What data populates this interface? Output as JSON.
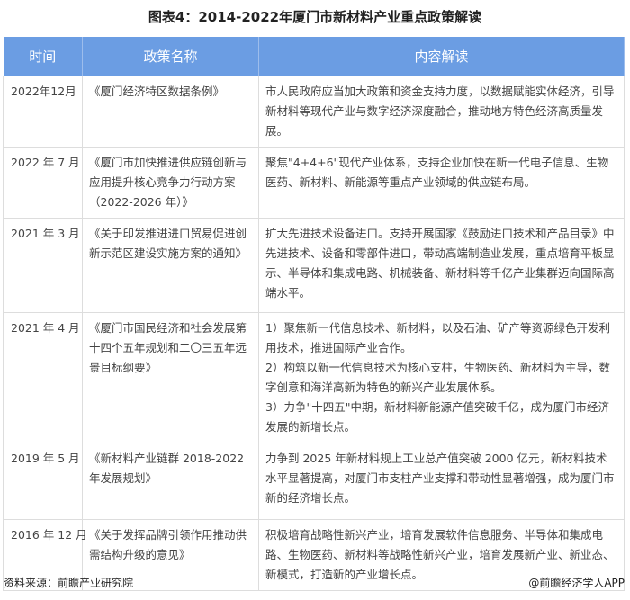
{
  "title": "图表4：2014-2022年厦门市新材料产业重点政策解读",
  "table": {
    "headers": [
      "时间",
      "政策名称",
      "内容解读"
    ],
    "rows": [
      {
        "time": "2022年12月",
        "policy": "《厦门经济特区数据条例》",
        "content": [
          "市人民政府应当加大政策和资金支持力度，以数据赋能实体经济，引导新材料等现代产业与数字经济深度融合，推动地方特色经济高质量发展。"
        ]
      },
      {
        "time": "2022 年 7 月",
        "policy": "《厦门市加快推进供应链创新与应用提升核心竞争力行动方案（2022-2026 年）》",
        "content": [
          "聚焦\"4+4+6\"现代产业体系，支持企业加快在新一代电子信息、生物医药、新材料、新能源等重点产业领域的供应链布局。"
        ]
      },
      {
        "time": "2021 年 3 月",
        "policy": "《关于印发推进进口贸易促进创新示范区建设实施方案的通知》",
        "content": [
          "扩大先进技术设备进口。支持开展国家《鼓励进口技术和产品目录》中先进技术、设备和零部件进口，带动高端制造业发展，重点培育平板显示、半导体和集成电路、机械装备、新材料等千亿产业集群迈向国际高端水平。"
        ]
      },
      {
        "time": "2021 年 4 月",
        "policy": "《厦门市国民经济和社会发展第十四个五年规划和二〇三五年远景目标纲要》",
        "content": [
          "1）聚焦新一代信息技术、新材料，以及石油、矿产等资源绿色开发利用技术，推进国际产业合作。",
          "2）构筑以新一代信息技术为核心支柱，生物医药、新材料为主导，数字创意和海洋高新为特色的新兴产业发展体系。",
          "3）力争\"十四五\"中期，新材料新能源产值突破千亿，成为厦门市经济发展的新增长点。"
        ]
      },
      {
        "time": "2019 年 5 月",
        "policy": "《新材料产业链群 2018-2022 年发展规划》",
        "content": [
          "力争到 2025 年新材料规上工业总产值突破 2000 亿元，新材料技术水平显著提高，对厦门市支柱产业支撑和带动性显著增强，成为厦门市新的经济增长点。"
        ]
      },
      {
        "time": "2016 年 12 月",
        "policy": "《关于发挥品牌引领作用推动供需结构升级的意见》",
        "content": [
          "积极培育战略性新兴产业，培育发展软件信息服务、半导体和集成电路、生物医药、新材料等战略性新兴产业，培育发展新产业、新业态、新模式，打造新的产业增长点。"
        ]
      }
    ]
  },
  "footer": {
    "source": "资料来源：前瞻产业研究院",
    "credit": "@前瞻经济学人APP"
  },
  "colors": {
    "header_bg": "#6b9de3",
    "border": "#dddddd"
  }
}
